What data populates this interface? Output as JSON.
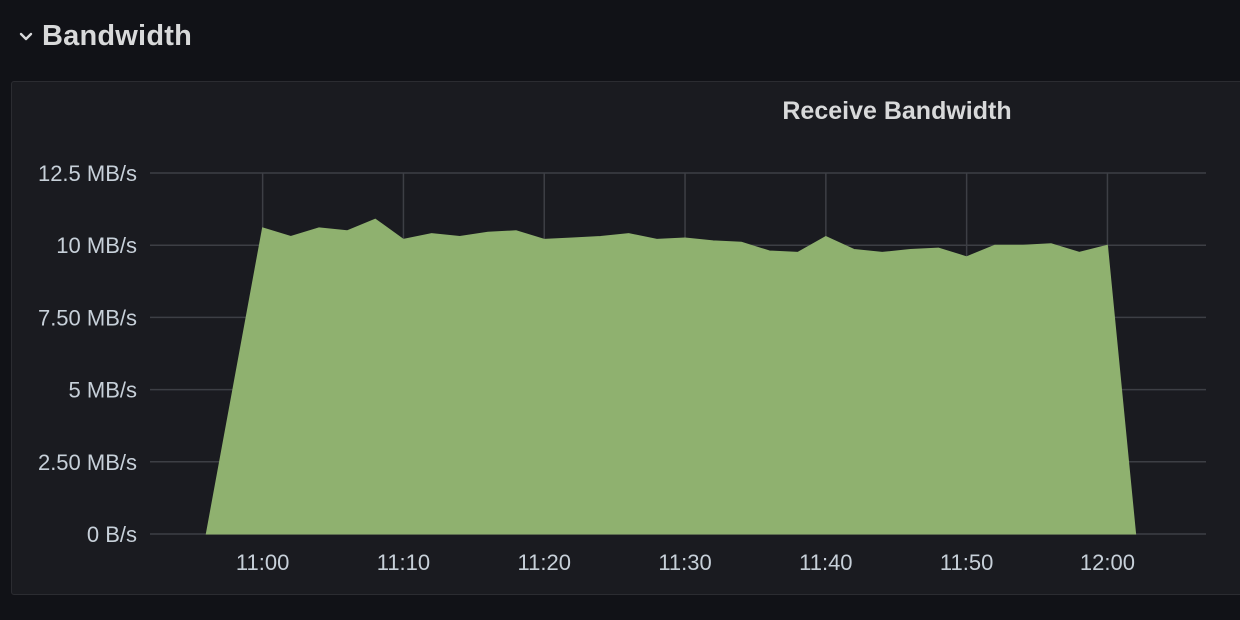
{
  "row": {
    "title": "Bandwidth",
    "toggle_icon": "chevron-down-icon"
  },
  "panel": {
    "title": "Receive Bandwidth"
  },
  "colors": {
    "background": "#111217",
    "panel_background": "#1a1b20",
    "series_fill": "#8fb16f",
    "grid": "#3d3f45",
    "text": "#d8d9da"
  },
  "chart_data": {
    "type": "area",
    "title": "Receive Bandwidth",
    "xlabel": "",
    "ylabel": "",
    "grid": true,
    "x_ticks": [
      "11:00",
      "11:10",
      "11:20",
      "11:30",
      "11:40",
      "11:50",
      "12:00"
    ],
    "y_ticks": [
      "0 B/s",
      "2.50 MB/s",
      "5 MB/s",
      "7.50 MB/s",
      "10 MB/s",
      "12.5 MB/s"
    ],
    "ylim": [
      0,
      12.5
    ],
    "xlim": [
      "10:52",
      "12:07"
    ],
    "y_unit": "MB/s",
    "series": [
      {
        "x": [
          "10:56",
          "11:00",
          "11:02",
          "11:04",
          "11:06",
          "11:08",
          "11:10",
          "11:12",
          "11:14",
          "11:16",
          "11:18",
          "11:20",
          "11:22",
          "11:24",
          "11:26",
          "11:28",
          "11:30",
          "11:32",
          "11:34",
          "11:36",
          "11:38",
          "11:40",
          "11:42",
          "11:44",
          "11:46",
          "11:48",
          "11:50",
          "11:52",
          "11:54",
          "11:56",
          "11:58",
          "12:00",
          "12:02"
        ],
        "values": [
          0,
          10.6,
          10.3,
          10.6,
          10.5,
          10.9,
          10.2,
          10.4,
          10.3,
          10.45,
          10.5,
          10.2,
          10.25,
          10.3,
          10.4,
          10.2,
          10.25,
          10.15,
          10.1,
          9.8,
          9.75,
          10.3,
          9.85,
          9.75,
          9.85,
          9.9,
          9.6,
          10.0,
          10.0,
          10.05,
          9.75,
          10.0,
          0
        ]
      }
    ]
  }
}
